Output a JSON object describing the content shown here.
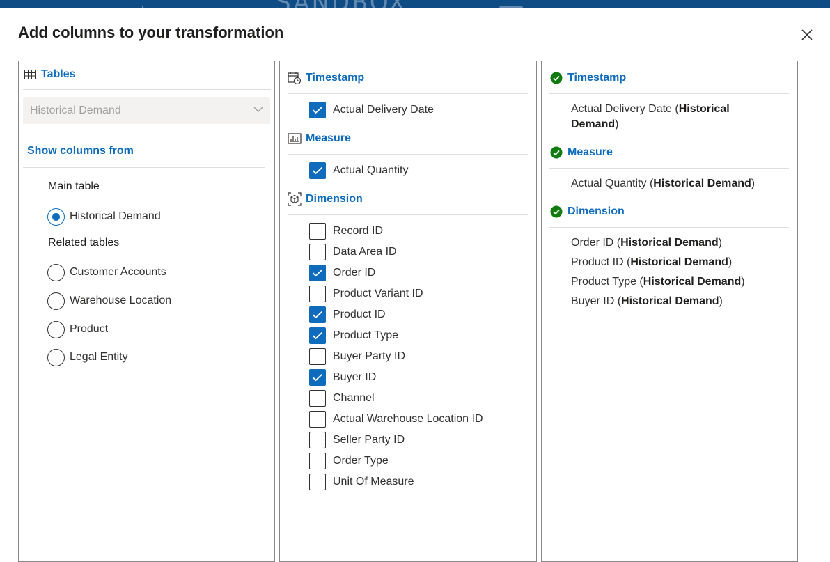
{
  "topbar": {
    "watermark": "SANDBOX"
  },
  "dialog": {
    "title": "Add columns to your transformation",
    "close_icon": "close-icon"
  },
  "tables_panel": {
    "heading": "Tables",
    "dropdown_value": "Historical Demand",
    "show_columns_from": "Show columns from",
    "main_table_label": "Main table",
    "main_table": {
      "label": "Historical Demand",
      "selected": true
    },
    "related_label": "Related tables",
    "related": [
      {
        "label": "Customer Accounts",
        "selected": false
      },
      {
        "label": "Warehouse Location",
        "selected": false
      },
      {
        "label": "Product",
        "selected": false
      },
      {
        "label": "Legal Entity",
        "selected": false
      }
    ]
  },
  "columns_panel": {
    "timestamp": {
      "heading": "Timestamp",
      "items": [
        {
          "label": "Actual Delivery Date",
          "checked": true
        }
      ]
    },
    "measure": {
      "heading": "Measure",
      "items": [
        {
          "label": "Actual Quantity",
          "checked": true
        }
      ]
    },
    "dimension": {
      "heading": "Dimension",
      "items": [
        {
          "label": "Record ID",
          "checked": false
        },
        {
          "label": "Data Area ID",
          "checked": false
        },
        {
          "label": "Order ID",
          "checked": true
        },
        {
          "label": "Product Variant ID",
          "checked": false
        },
        {
          "label": "Product ID",
          "checked": true
        },
        {
          "label": "Product Type",
          "checked": true
        },
        {
          "label": "Buyer Party ID",
          "checked": false
        },
        {
          "label": "Buyer ID",
          "checked": true
        },
        {
          "label": "Channel",
          "checked": false
        },
        {
          "label": "Actual Warehouse Location ID",
          "checked": false
        },
        {
          "label": "Seller Party ID",
          "checked": false
        },
        {
          "label": "Order Type",
          "checked": false
        },
        {
          "label": "Unit Of Measure",
          "checked": false
        }
      ]
    }
  },
  "selected_panel": {
    "timestamp": {
      "heading": "Timestamp",
      "items": [
        {
          "column": "Actual Delivery Date",
          "table": "Historical Demand"
        }
      ]
    },
    "measure": {
      "heading": "Measure",
      "items": [
        {
          "column": "Actual Quantity",
          "table": "Historical Demand"
        }
      ]
    },
    "dimension": {
      "heading": "Dimension",
      "items": [
        {
          "column": "Order ID",
          "table": "Historical Demand"
        },
        {
          "column": "Product ID",
          "table": "Historical Demand"
        },
        {
          "column": "Product Type",
          "table": "Historical Demand"
        },
        {
          "column": "Buyer ID",
          "table": "Historical Demand"
        }
      ]
    }
  },
  "colors": {
    "accent": "#0f6cbd",
    "success": "#107c10",
    "topbar": "#0f4b85"
  }
}
